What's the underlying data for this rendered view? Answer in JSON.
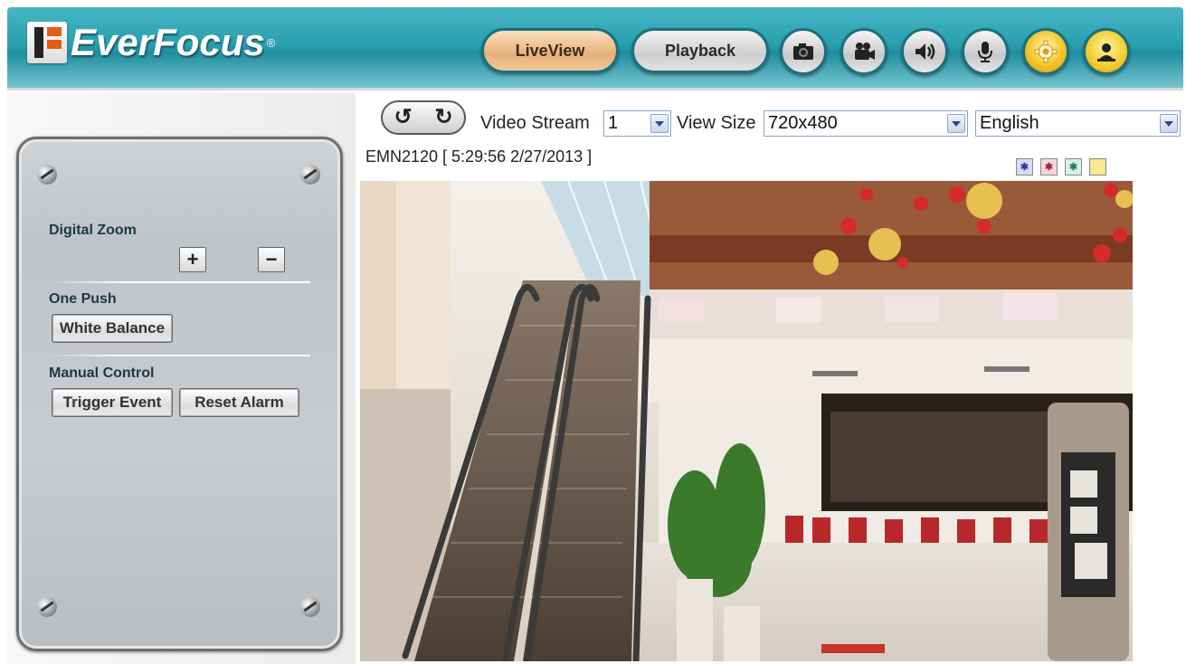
{
  "brand": {
    "name": "EverFocus",
    "reg_mark": "®"
  },
  "nav": {
    "liveview_label": "LiveView",
    "playback_label": "Playback",
    "icons": [
      "camera-snapshot-icon",
      "video-record-icon",
      "speaker-icon",
      "microphone-icon",
      "settings-gear-icon",
      "logout-icon"
    ]
  },
  "toolbar": {
    "rotate_left_glyph": "↺",
    "rotate_right_glyph": "↻",
    "video_stream_label": "Video Stream",
    "video_stream_value": "1",
    "view_size_label": "View Size",
    "view_size_value": "720x480",
    "language_value": "English"
  },
  "camera": {
    "title": "EMN2120 [ 5:29:56 2/27/2013 ]",
    "status_icons": [
      "motion-detect-icon",
      "alarm-motion-icon",
      "event-motion-icon",
      "light-icon"
    ]
  },
  "panel": {
    "digital_zoom_label": "Digital Zoom",
    "zoom_in_label": "+",
    "zoom_out_label": "−",
    "one_push_label": "One Push",
    "white_balance_label": "White Balance",
    "manual_control_label": "Manual Control",
    "trigger_event_label": "Trigger Event",
    "reset_alarm_label": "Reset Alarm"
  },
  "colors": {
    "header_teal": "#2a9fb0",
    "liveview_active": "#e8b078",
    "panel_gray": "#c4c8cc"
  }
}
